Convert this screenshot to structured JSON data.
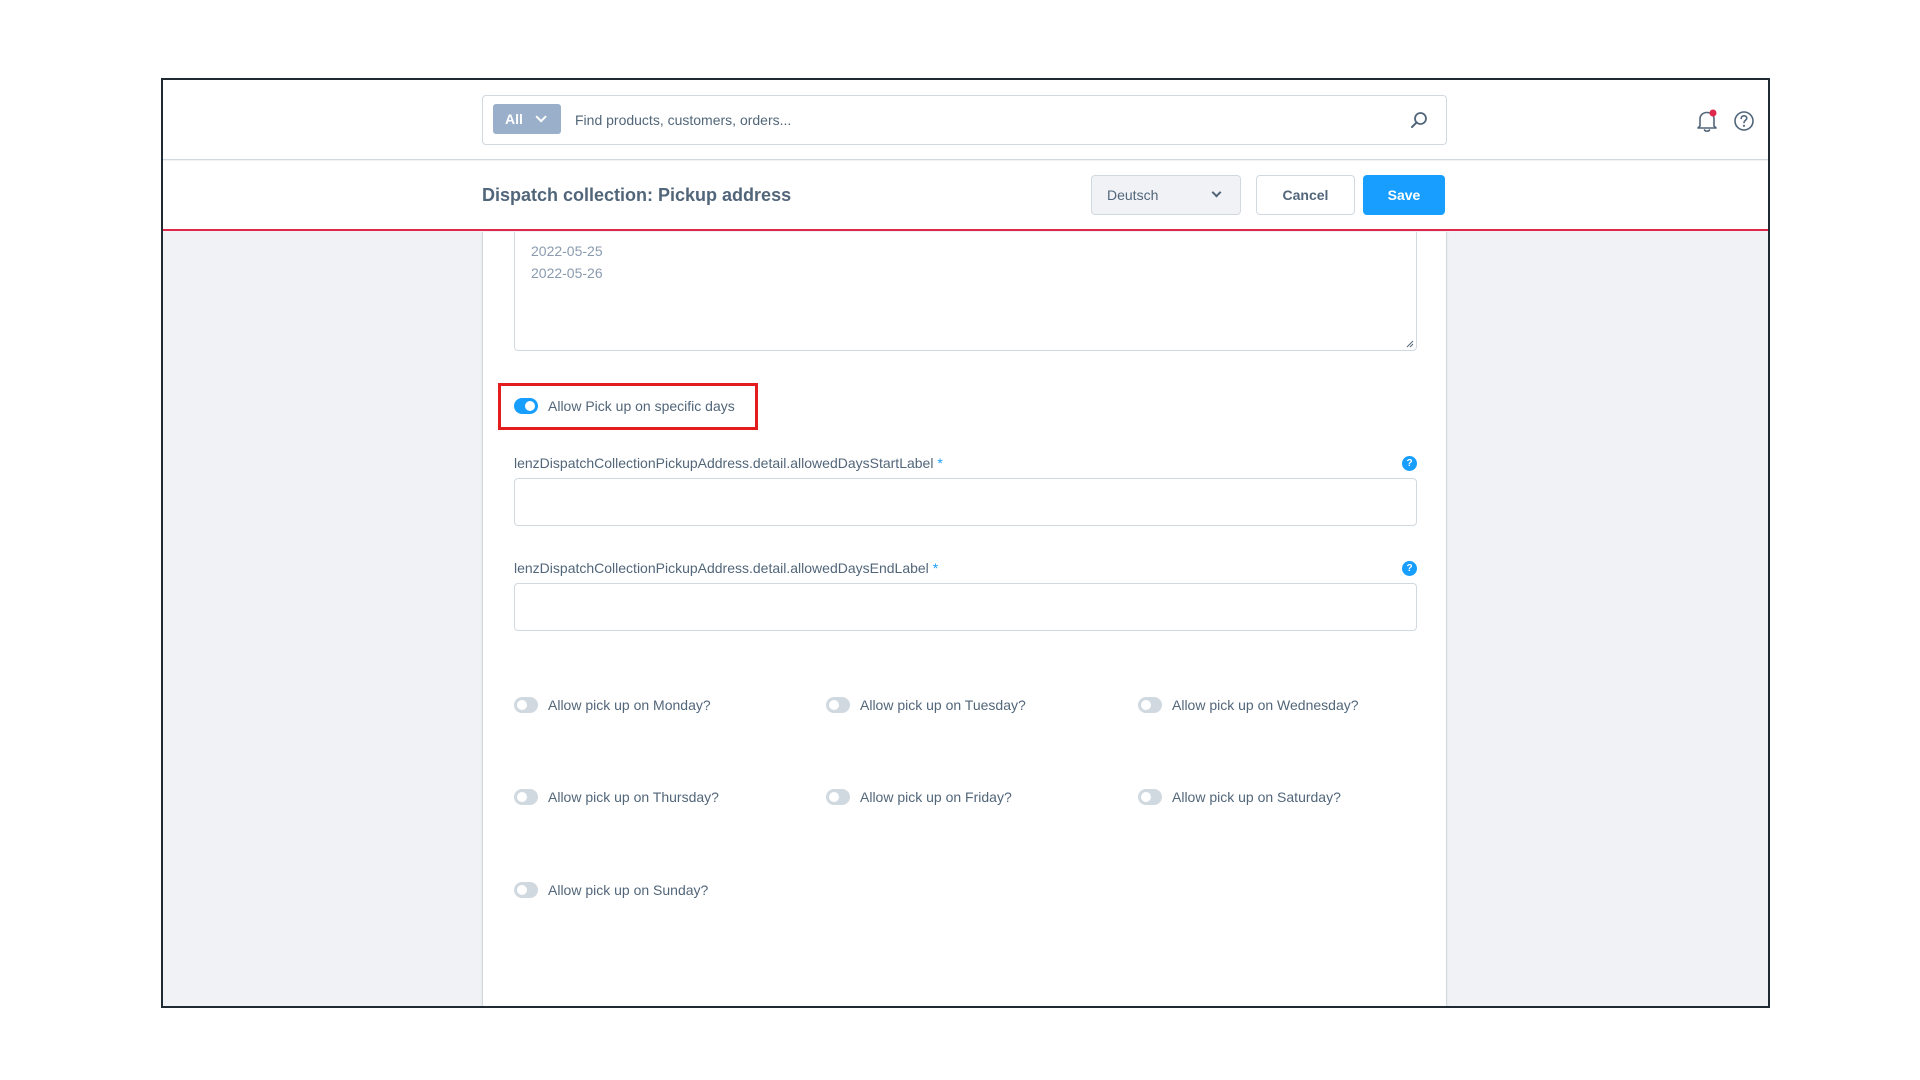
{
  "search": {
    "type_label": "All",
    "placeholder": "Find products, customers, orders..."
  },
  "smartbar": {
    "title": "Dispatch collection: Pickup address",
    "language": "Deutsch",
    "cancel_label": "Cancel",
    "save_label": "Save"
  },
  "dates": {
    "lines": [
      "2022-05-25",
      "2022-05-26"
    ]
  },
  "specific_days": {
    "label": "Allow Pick up on specific days",
    "enabled": true
  },
  "fields": {
    "start_label": "lenzDispatchCollectionPickupAddress.detail.allowedDaysStartLabel",
    "end_label": "lenzDispatchCollectionPickupAddress.detail.allowedDaysEndLabel",
    "required_mark": "*",
    "help_glyph": "?"
  },
  "days": [
    {
      "label": "Allow pick up on Monday?",
      "enabled": false
    },
    {
      "label": "Allow pick up on Tuesday?",
      "enabled": false
    },
    {
      "label": "Allow pick up on Wednesday?",
      "enabled": false
    },
    {
      "label": "Allow pick up on Thursday?",
      "enabled": false
    },
    {
      "label": "Allow pick up on Friday?",
      "enabled": false
    },
    {
      "label": "Allow pick up on Saturday?",
      "enabled": false
    },
    {
      "label": "Allow pick up on Sunday?",
      "enabled": false
    }
  ],
  "colors": {
    "accent": "#189eff",
    "highlight": "#e31d1d",
    "smartbar_border": "#de294c",
    "notification_dot": "#de294c"
  }
}
